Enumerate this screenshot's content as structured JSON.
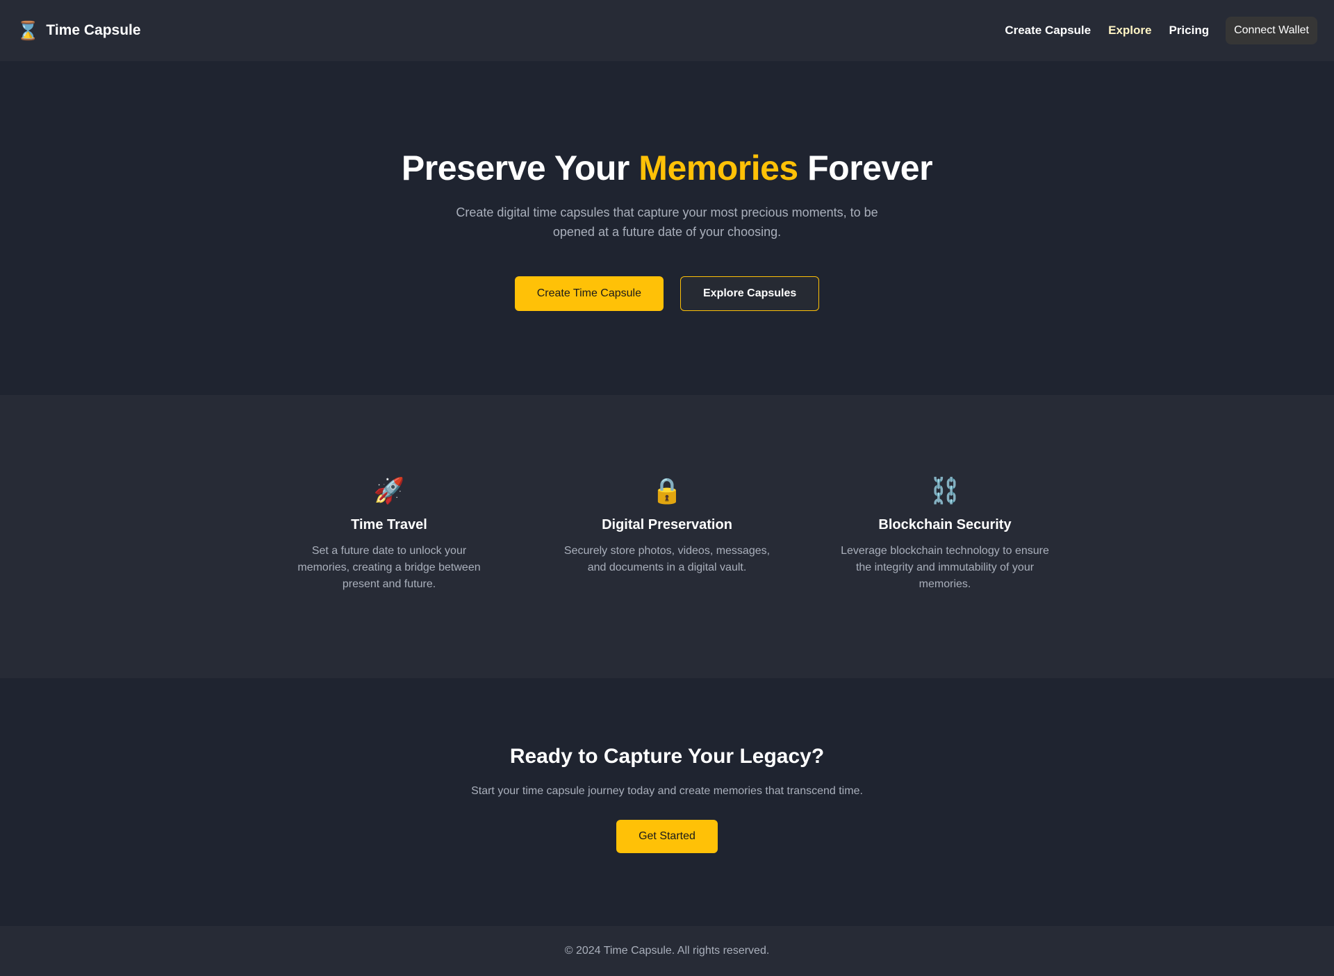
{
  "header": {
    "brand_icon": "⌛",
    "brand_name": "Time Capsule",
    "nav": [
      {
        "label": "Create Capsule"
      },
      {
        "label": "Explore"
      },
      {
        "label": "Pricing"
      }
    ],
    "wallet_button": "Connect Wallet"
  },
  "hero": {
    "title_before": "Preserve Your ",
    "title_accent": "Memories",
    "title_after": " Forever",
    "subtitle": "Create digital time capsules that capture your most precious moments, to be opened at a future date of your choosing.",
    "primary_button": "Create Time Capsule",
    "secondary_button": "Explore Capsules"
  },
  "features": [
    {
      "icon": "🚀",
      "icon_name": "rocket-icon",
      "title": "Time Travel",
      "description": "Set a future date to unlock your memories, creating a bridge between present and future."
    },
    {
      "icon": "🔒",
      "icon_name": "lock-icon",
      "title": "Digital Preservation",
      "description": "Securely store photos, videos, messages, and documents in a digital vault."
    },
    {
      "icon": "⛓️",
      "icon_name": "chain-icon",
      "title": "Blockchain Security",
      "description": "Leverage blockchain technology to ensure the integrity and immutability of your memories."
    }
  ],
  "cta": {
    "title": "Ready to Capture Your Legacy?",
    "subtitle": "Start your time capsule journey today and create memories that transcend time.",
    "button": "Get Started"
  },
  "footer": {
    "text": "© 2024 Time Capsule. All rights reserved."
  },
  "colors": {
    "accent": "#ffc107",
    "background": "#1f2430",
    "surface": "#272b36",
    "muted_text": "#aab0bc"
  }
}
